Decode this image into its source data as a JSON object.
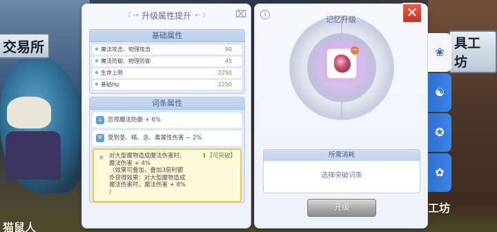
{
  "background": {
    "sign_left": "交易所",
    "sign_right": "具工坊",
    "bottom_left": "猫鼠人",
    "bottom_right": "工坊",
    "bottom_mid": "... ... ..."
  },
  "attr_panel": {
    "title": "升级属性提升",
    "base_section": {
      "title": "基础属性",
      "rows": [
        {
          "label": "魔法攻击、物理攻击",
          "value": "90"
        },
        {
          "label": "魔法防御、物理防御",
          "value": "45"
        },
        {
          "label": "生命上限",
          "value": "2250"
        },
        {
          "label": "基础Hp",
          "value": "2250"
        }
      ]
    },
    "entry_section": {
      "title": "词条属性",
      "rows": [
        {
          "icon": "sword-icon",
          "text": "忽视魔法防御 + 6%"
        },
        {
          "icon": "shield-icon",
          "text": "受到圣、暗、念、毒属性伤害 − 2%"
        }
      ],
      "special": {
        "icon": "snowflake-icon",
        "badge": "【可突破】",
        "lines": [
          "对大型魔物造成魔法伤害时,",
          "魔法伤害 + 4%",
          "（效果可叠加，叠加3层时额",
          "外获得效果：对大型魔物造成",
          "魔法伤害时，魔法伤害 + 8%",
          "）"
        ]
      }
    }
  },
  "memory_panel": {
    "title": "记忆升级",
    "info_label": "i",
    "cost_title": "所需消耗",
    "cost_placeholder": "选择突破词条",
    "upgrade_button": "升级"
  },
  "close_label": "✕",
  "tabs": [
    "tab-memory",
    "tab-refine",
    "tab-enchant",
    "tab-card"
  ],
  "colors": {
    "accent_blue": "#3a86e8",
    "close_red": "#e0472f",
    "breakable_green": "#3e9a3a",
    "highlight_border": "#f0c84e"
  }
}
